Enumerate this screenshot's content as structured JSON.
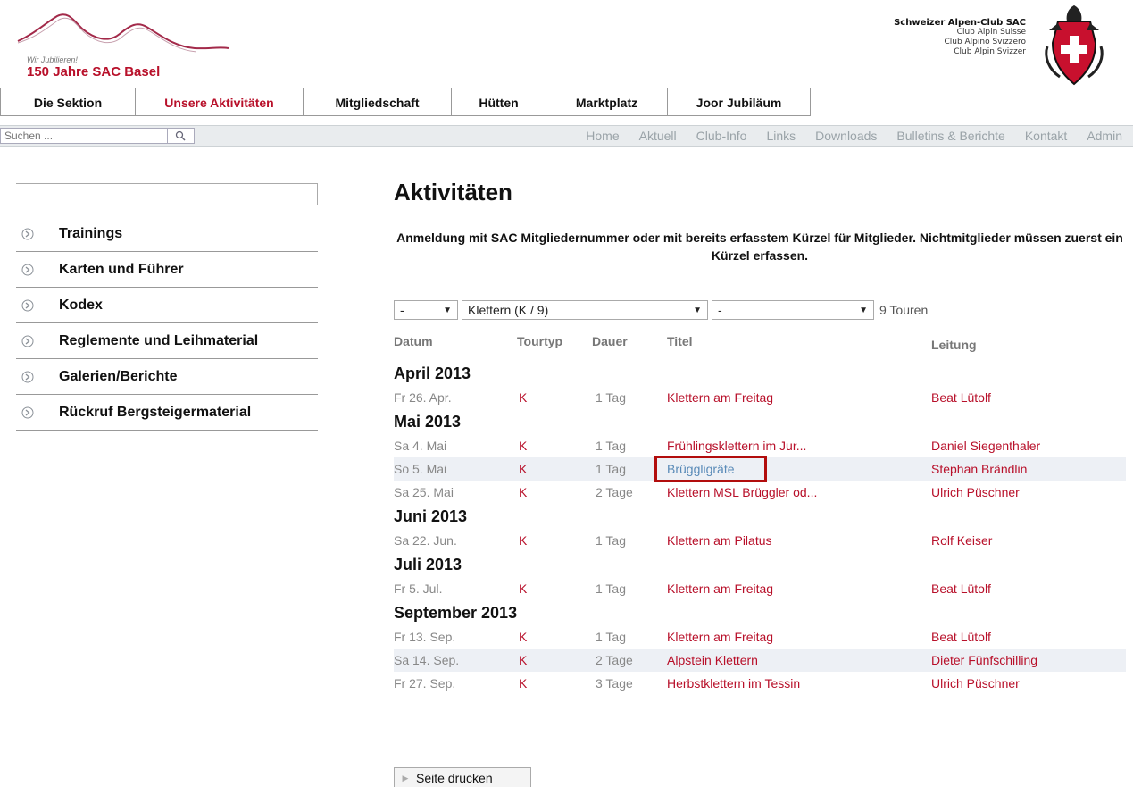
{
  "logo": {
    "subtitle": "Wir Jubilieren!",
    "title": "150 Jahre SAC Basel"
  },
  "brand": {
    "line1": "Schweizer Alpen-Club SAC",
    "line2": "Club Alpin Suisse",
    "line3": "Club Alpino Svizzero",
    "line4": "Club Alpin Svizzer"
  },
  "mainnav": [
    {
      "label": "Die Sektion"
    },
    {
      "label": "Unsere Aktivitäten"
    },
    {
      "label": "Mitgliedschaft"
    },
    {
      "label": "Hütten"
    },
    {
      "label": "Marktplatz"
    },
    {
      "label": "Joor Jubiläum"
    }
  ],
  "search": {
    "placeholder": "Suchen ..."
  },
  "sublinks": [
    {
      "label": "Home"
    },
    {
      "label": "Aktuell"
    },
    {
      "label": "Club-Info"
    },
    {
      "label": "Links"
    },
    {
      "label": "Downloads"
    },
    {
      "label": "Bulletins & Berichte"
    },
    {
      "label": "Kontakt"
    },
    {
      "label": "Admin"
    }
  ],
  "sidebar": [
    {
      "label": "Trainings"
    },
    {
      "label": "Karten und Führer"
    },
    {
      "label": "Kodex"
    },
    {
      "label": "Reglemente und Leihmaterial"
    },
    {
      "label": "Galerien/Berichte"
    },
    {
      "label": "Rückruf Bergsteigermaterial"
    }
  ],
  "content": {
    "title": "Aktivitäten",
    "notice": "Anmeldung mit SAC Mitgliedernummer oder mit bereits erfasstem Kürzel für Mitglieder. Nichtmitglieder müssen zuerst ein Kürzel erfassen.",
    "filter1": "-",
    "filter2": "Klettern (K / 9)",
    "filter3": "-",
    "count": "9 Touren",
    "headers": {
      "datum": "Datum",
      "tourtyp": "Tourtyp",
      "dauer": "Dauer",
      "titel": "Titel",
      "leitung": "Leitung"
    },
    "print_label": "Seite drucken"
  },
  "groups": [
    {
      "month": "April 2013",
      "rows": [
        {
          "date": "Fr 26. Apr.",
          "typ": "K",
          "dauer": "1 Tag",
          "titel": "Klettern am Freitag",
          "leitung": "Beat Lütolf"
        }
      ]
    },
    {
      "month": "Mai 2013",
      "rows": [
        {
          "date": "Sa 4. Mai",
          "typ": "K",
          "dauer": "1 Tag",
          "titel": "Frühlingsklettern im Jur...",
          "leitung": "Daniel Siegenthaler"
        },
        {
          "date": "So 5. Mai",
          "typ": "K",
          "dauer": "1 Tag",
          "titel": "Brüggligräte",
          "leitung": "Stephan Brändlin"
        },
        {
          "date": "Sa 25. Mai",
          "typ": "K",
          "dauer": "2 Tage",
          "titel": "Klettern MSL Brüggler od...",
          "leitung": "Ulrich Püschner"
        }
      ]
    },
    {
      "month": "Juni 2013",
      "rows": [
        {
          "date": "Sa 22. Jun.",
          "typ": "K",
          "dauer": "1 Tag",
          "titel": "Klettern am Pilatus",
          "leitung": "Rolf Keiser"
        }
      ]
    },
    {
      "month": "Juli 2013",
      "rows": [
        {
          "date": "Fr 5. Jul.",
          "typ": "K",
          "dauer": "1 Tag",
          "titel": "Klettern am Freitag",
          "leitung": "Beat Lütolf"
        }
      ]
    },
    {
      "month": "September 2013",
      "rows": [
        {
          "date": "Fr 13. Sep.",
          "typ": "K",
          "dauer": "1 Tag",
          "titel": "Klettern am Freitag",
          "leitung": "Beat Lütolf"
        },
        {
          "date": "Sa 14. Sep.",
          "typ": "K",
          "dauer": "2 Tage",
          "titel": "Alpstein Klettern",
          "leitung": "Dieter Fünfschilling"
        },
        {
          "date": "Fr 27. Sep.",
          "typ": "K",
          "dauer": "3 Tage",
          "titel": "Herbstklettern im Tessin",
          "leitung": "Ulrich Püschner"
        }
      ]
    }
  ],
  "colors": {
    "accent": "#b8102a",
    "link_hover": "#5a8bb8",
    "highlight_box": "#b20d0d"
  }
}
